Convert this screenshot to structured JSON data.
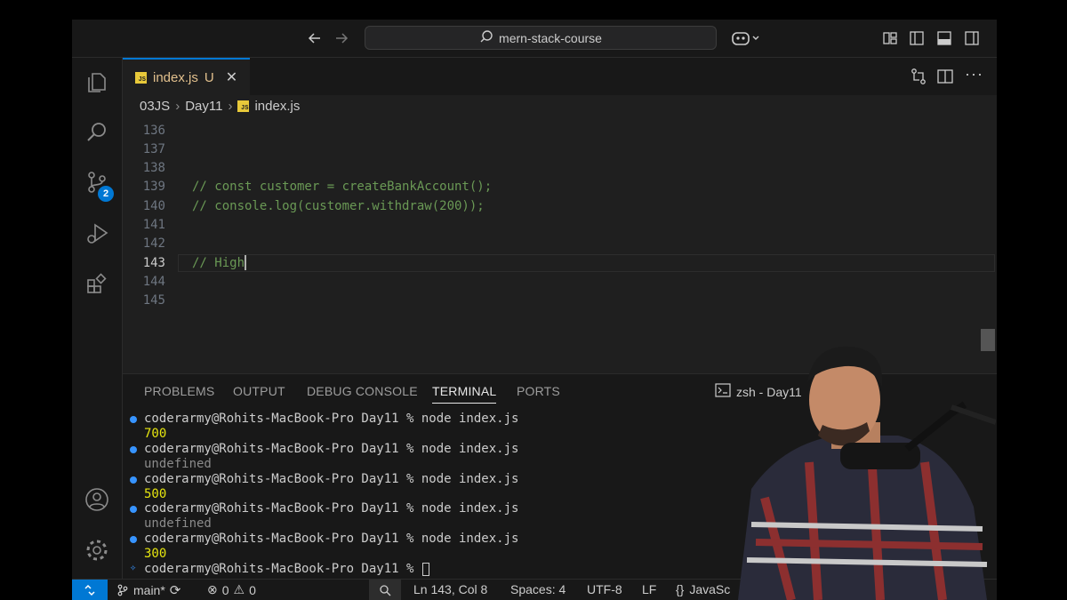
{
  "titlebar": {
    "search_text": "mern-stack-course",
    "icons": [
      "arrow-left-icon",
      "arrow-right-icon",
      "search-icon",
      "copilot-icon",
      "layout-icon",
      "sidebar-toggle-icon",
      "panel-toggle-icon",
      "secondary-sidebar-icon"
    ]
  },
  "activity_bar": {
    "items": [
      "explorer-icon",
      "search-icon",
      "source-control-icon",
      "run-debug-icon",
      "extensions-icon"
    ],
    "source_control_badge": "2",
    "bottom": [
      "account-icon",
      "settings-icon"
    ]
  },
  "tab": {
    "label": "index.js",
    "status": "U",
    "icon_text": "JS"
  },
  "editor_actions": [
    "compare-changes-icon",
    "split-editor-icon",
    "more-icon"
  ],
  "breadcrumb": {
    "items": [
      "03JS",
      "Day11",
      "index.js"
    ]
  },
  "editor": {
    "lines": [
      {
        "num": "136",
        "text": ""
      },
      {
        "num": "137",
        "text": ""
      },
      {
        "num": "138",
        "text": ""
      },
      {
        "num": "139",
        "text": "// const customer = createBankAccount();"
      },
      {
        "num": "140",
        "text": "// console.log(customer.withdraw(200));"
      },
      {
        "num": "141",
        "text": ""
      },
      {
        "num": "142",
        "text": ""
      },
      {
        "num": "143",
        "text": "// High"
      },
      {
        "num": "144",
        "text": ""
      },
      {
        "num": "145",
        "text": ""
      }
    ],
    "current_line": "143"
  },
  "panel": {
    "tabs": [
      "PROBLEMS",
      "OUTPUT",
      "DEBUG CONSOLE",
      "TERMINAL",
      "PORTS"
    ],
    "active_tab": "TERMINAL",
    "terminal_name": "zsh - Day11",
    "terminal_lines": [
      {
        "type": "cmd",
        "text": "coderarmy@Rohits-MacBook-Pro Day11 % node index.js"
      },
      {
        "type": "out",
        "text": "700"
      },
      {
        "type": "cmd",
        "text": "coderarmy@Rohits-MacBook-Pro Day11 % node index.js"
      },
      {
        "type": "dim",
        "text": "undefined"
      },
      {
        "type": "cmd",
        "text": "coderarmy@Rohits-MacBook-Pro Day11 % node index.js"
      },
      {
        "type": "out",
        "text": "500"
      },
      {
        "type": "cmd",
        "text": "coderarmy@Rohits-MacBook-Pro Day11 % node index.js"
      },
      {
        "type": "dim",
        "text": "undefined"
      },
      {
        "type": "cmd",
        "text": "coderarmy@Rohits-MacBook-Pro Day11 % node index.js"
      },
      {
        "type": "out",
        "text": "300"
      },
      {
        "type": "prompt",
        "text": "coderarmy@Rohits-MacBook-Pro Day11 % "
      }
    ]
  },
  "statusbar": {
    "branch": "main*",
    "errors": "0",
    "warnings": "0",
    "position": "Ln 143, Col 8",
    "spaces": "Spaces: 4",
    "encoding": "UTF-8",
    "eol": "LF",
    "language": "JavaSc"
  },
  "colors": {
    "accent": "#0078d4",
    "comment": "#6a9955",
    "terminal_output": "#e5e510",
    "js_icon": "#e8c93a"
  }
}
